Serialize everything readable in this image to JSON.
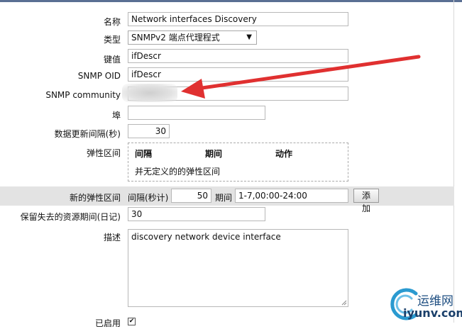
{
  "form": {
    "name": {
      "label": "名称",
      "value": "Network interfaces Discovery"
    },
    "type": {
      "label": "类型",
      "selected": "SNMPv2 端点代理程式"
    },
    "key": {
      "label": "键值",
      "value": "ifDescr"
    },
    "snmp_oid": {
      "label": "SNMP OID",
      "value": "ifDescr"
    },
    "snmp_community": {
      "label": "SNMP community"
    },
    "port": {
      "label": "埠",
      "value": ""
    },
    "update_interval": {
      "label": "数据更新间隔(秒)",
      "value": "30"
    },
    "flexible_intervals": {
      "label": "弹性区间",
      "headers": [
        "间隔",
        "期间",
        "动作"
      ],
      "empty_text": "并无定义的的弹性区间"
    },
    "new_flexible_interval": {
      "label": "新的弹性区间",
      "interval_label": "间隔(秒计)",
      "interval_value": "50",
      "period_label": "期间",
      "period_value": "1-7,00:00-24:00",
      "add_button": "添加"
    },
    "keep_lost_resources": {
      "label": "保留失去的资源期间(日记)",
      "value": "30"
    },
    "description": {
      "label": "描述",
      "value": "discovery network device interface"
    },
    "enabled": {
      "label": "已启用",
      "checked": true
    }
  },
  "watermark": {
    "cn": "运维网",
    "url": "iyunv.com"
  },
  "colors": {
    "arrow": "#e03030",
    "band": "#e3e3e3",
    "header_rule": "#5a6f93"
  }
}
